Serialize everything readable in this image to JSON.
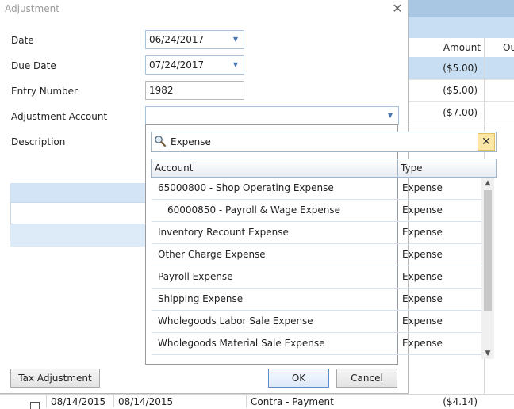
{
  "dialog": {
    "title": "Adjustment",
    "fields": {
      "date_label": "Date",
      "date_value": "06/24/2017",
      "due_date_label": "Due Date",
      "due_date_value": "07/24/2017",
      "entry_number_label": "Entry Number",
      "entry_number_value": "1982",
      "adjustment_account_label": "Adjustment Account",
      "adjustment_account_value": "",
      "description_label": "Description"
    },
    "buttons": {
      "tax_adjustment": "Tax Adjustment",
      "ok": "OK",
      "cancel": "Cancel"
    }
  },
  "popup": {
    "search_value": "Expense",
    "columns": [
      "Account",
      "Type"
    ],
    "rows": [
      {
        "account": "65000800 - Shop Operating Expense",
        "type": "Expense",
        "indent": 0
      },
      {
        "account": "60000850 - Payroll & Wage Expense",
        "type": "Expense",
        "indent": 1
      },
      {
        "account": "Inventory Recount Expense",
        "type": "Expense",
        "indent": 0
      },
      {
        "account": "Other Charge Expense",
        "type": "Expense",
        "indent": 0
      },
      {
        "account": "Payroll Expense",
        "type": "Expense",
        "indent": 0
      },
      {
        "account": "Shipping Expense",
        "type": "Expense",
        "indent": 0
      },
      {
        "account": "Wholegoods Labor Sale Expense",
        "type": "Expense",
        "indent": 0
      },
      {
        "account": "Wholegoods Material Sale Expense",
        "type": "Expense",
        "indent": 0
      }
    ]
  },
  "background_grid": {
    "amount_header": "Amount",
    "next_header_partial": "Ou",
    "amounts": [
      "($5.00)",
      "($5.00)",
      "($7.00)"
    ],
    "bottom_row": {
      "date1": "08/14/2015",
      "date2": "08/14/2015",
      "desc": "Contra - Payment",
      "amount": "($4.14)"
    }
  },
  "colors": {
    "accent": "#4a76b0",
    "selected_row": "#c7def3",
    "header_bar": "#a9c7e3"
  }
}
